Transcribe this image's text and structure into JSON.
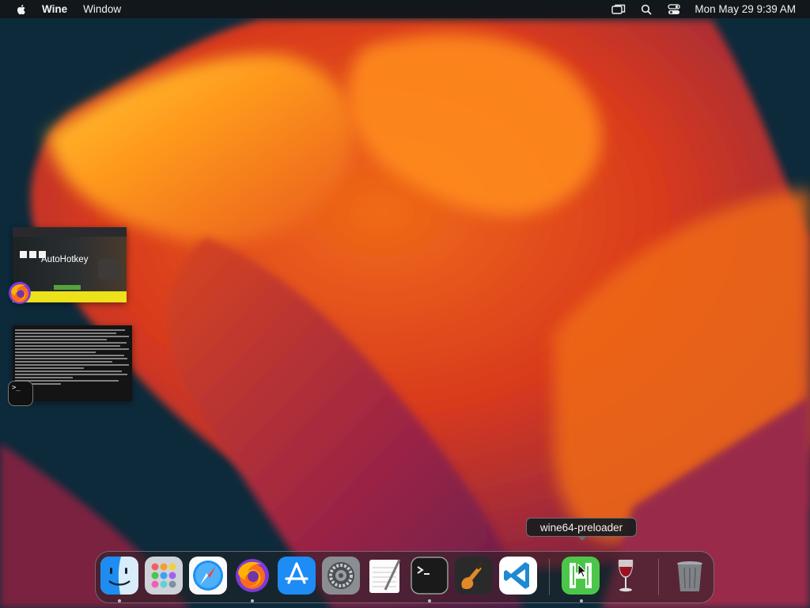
{
  "menubar": {
    "app_name": "Wine",
    "menus": [
      "Window"
    ],
    "clock": "Mon May 29  9:39 AM",
    "status_icons": [
      "screen-mirroring-icon",
      "search-icon",
      "control-center-icon"
    ]
  },
  "desktop": {
    "windows": [
      {
        "app": "Firefox",
        "page_title": "AutoHotkey",
        "icon": "firefox-icon"
      },
      {
        "app": "Terminal",
        "prompt": ">_",
        "icon": "terminal-icon"
      }
    ]
  },
  "tooltip": {
    "text": "wine64-preloader"
  },
  "dock": {
    "apps": [
      {
        "name": "Finder",
        "icon": "finder-icon",
        "running": true
      },
      {
        "name": "Launchpad",
        "icon": "launchpad-icon",
        "running": false
      },
      {
        "name": "Safari",
        "icon": "safari-icon",
        "running": false
      },
      {
        "name": "Firefox",
        "icon": "firefox-icon",
        "running": true
      },
      {
        "name": "App Store",
        "icon": "app-store-icon",
        "running": false
      },
      {
        "name": "System Preferences",
        "icon": "system-preferences-icon",
        "running": false
      },
      {
        "name": "TextEdit",
        "icon": "textedit-icon",
        "running": false
      },
      {
        "name": "Terminal",
        "icon": "terminal-icon",
        "running": true
      },
      {
        "name": "GarageBand",
        "icon": "garageband-icon",
        "running": false
      },
      {
        "name": "Visual Studio Code",
        "icon": "vscode-icon",
        "running": false
      },
      {
        "name": "wine64-preloader",
        "icon": "wine-preloader-icon",
        "running": true
      },
      {
        "name": "Wine",
        "icon": "wine-glass-icon",
        "running": false
      },
      {
        "name": "Trash",
        "icon": "trash-icon",
        "running": false
      }
    ]
  },
  "colors": {
    "wallpaper_orange": "#f07a16",
    "wallpaper_red": "#c42d22",
    "wallpaper_magenta": "#8a2145",
    "wallpaper_navy": "#0d2a3b"
  }
}
